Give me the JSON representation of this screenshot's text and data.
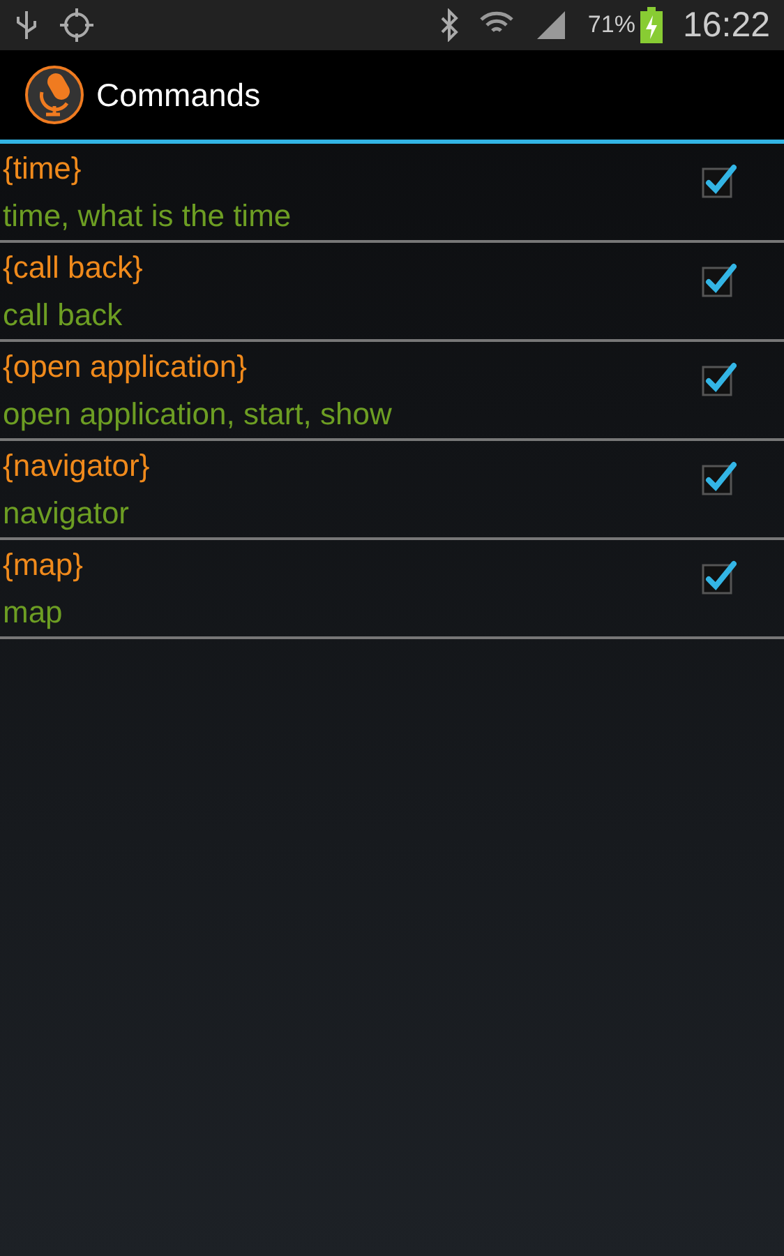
{
  "status_bar": {
    "battery": "71%",
    "time": "16:22"
  },
  "action_bar": {
    "title": "Commands"
  },
  "commands": [
    {
      "name": "{time}",
      "phrases": "time, what is the time",
      "checked": true
    },
    {
      "name": "{call back}",
      "phrases": "call back",
      "checked": true
    },
    {
      "name": "{open application}",
      "phrases": "open application, start, show",
      "checked": true
    },
    {
      "name": "{navigator}",
      "phrases": "navigator",
      "checked": true
    },
    {
      "name": "{map}",
      "phrases": "map",
      "checked": true
    }
  ]
}
